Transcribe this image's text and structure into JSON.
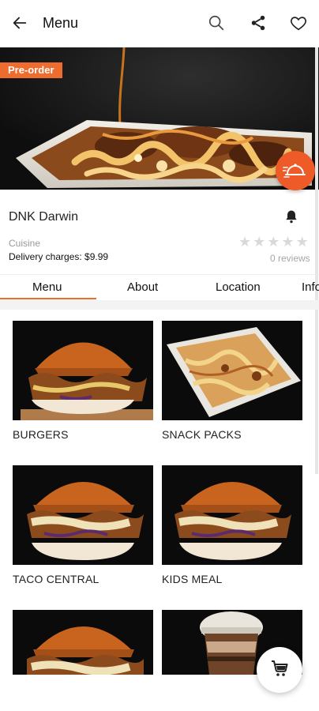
{
  "header": {
    "title": "Menu",
    "back_icon": "arrow-left-icon",
    "search_icon": "search-icon",
    "share_icon": "share-icon",
    "favorite_icon": "heart-icon"
  },
  "hero": {
    "badge": "Pre-order",
    "delivery_icon": "delivery-cloche-icon"
  },
  "restaurant": {
    "name": "DNK Darwin",
    "cuisine_label": "Cuisine",
    "delivery_charges": "Delivery charges: $9.99",
    "rating_stars": 0,
    "reviews": "0 reviews"
  },
  "tabs": [
    {
      "label": "Menu",
      "active": true
    },
    {
      "label": "About"
    },
    {
      "label": "Location"
    },
    {
      "label": "Info"
    }
  ],
  "categories": [
    {
      "label": "BURGERS"
    },
    {
      "label": "SNACK PACKS"
    },
    {
      "label": "TACO CENTRAL"
    },
    {
      "label": "KIDS MEAL"
    },
    {
      "label": ""
    },
    {
      "label": ""
    }
  ],
  "colors": {
    "accent": "#ee6c2d",
    "fab": "#ee5a28"
  },
  "cart_icon": "cart-icon"
}
